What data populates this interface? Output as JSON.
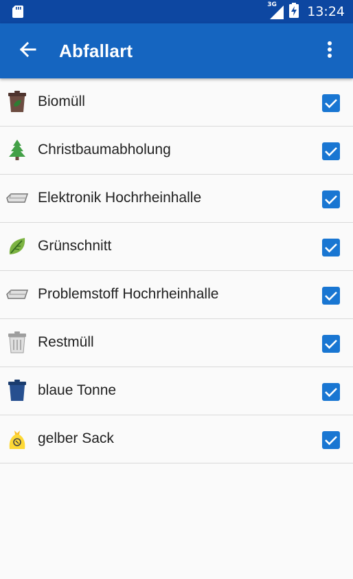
{
  "status_bar": {
    "network": "3G",
    "time": "13:24"
  },
  "toolbar": {
    "title": "Abfallart",
    "back_icon": "arrow-back-icon",
    "menu_icon": "more-vert-icon"
  },
  "colors": {
    "status_bar": "#0d47a1",
    "app_bar": "#1565c0",
    "checkbox": "#1976d2"
  },
  "items": [
    {
      "label": "Biomüll",
      "icon": "brown-bin-icon",
      "checked": true
    },
    {
      "label": "Christbaumabholung",
      "icon": "christmas-tree-icon",
      "checked": true
    },
    {
      "label": "Elektronik Hochrheinhalle",
      "icon": "electronics-tray-icon",
      "checked": true
    },
    {
      "label": "Grünschnitt",
      "icon": "leaf-icon",
      "checked": true
    },
    {
      "label": "Problemstoff Hochrheinhalle",
      "icon": "hazardous-tray-icon",
      "checked": true
    },
    {
      "label": "Restmüll",
      "icon": "grey-bin-icon",
      "checked": true
    },
    {
      "label": "blaue Tonne",
      "icon": "blue-bin-icon",
      "checked": true
    },
    {
      "label": "gelber Sack",
      "icon": "yellow-sack-icon",
      "checked": true
    }
  ]
}
